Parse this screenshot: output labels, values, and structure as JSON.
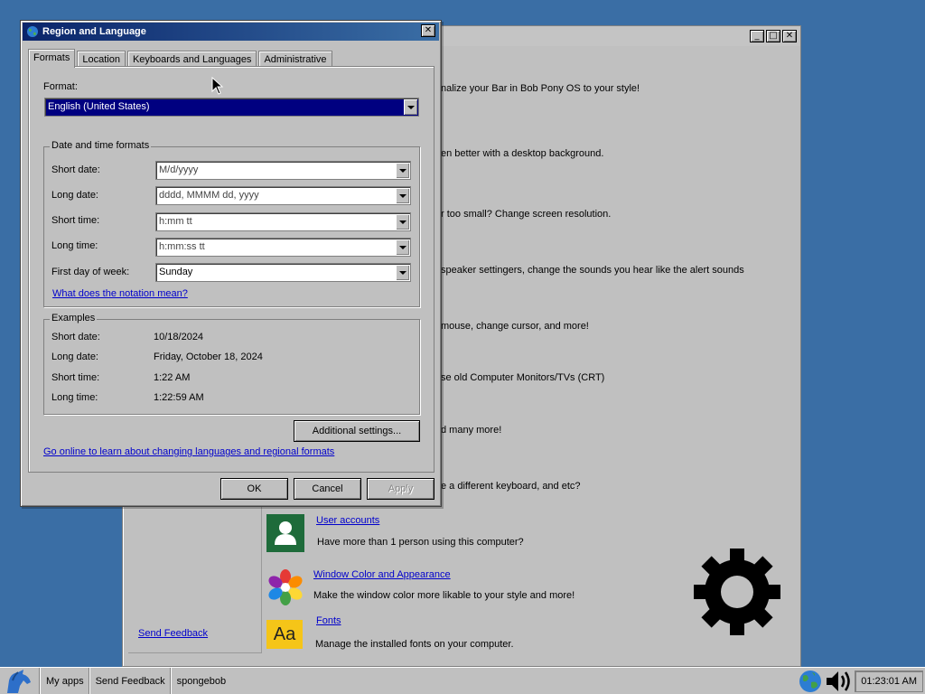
{
  "background_window": {
    "descriptions": [
      "nalize your Bar in Bob Pony OS to your style!",
      "en better with a desktop background.",
      "r too small? Change screen resolution.",
      "speaker settingers, change the sounds you hear like the alert sounds",
      "mouse, change cursor, and more!",
      "se old Computer Monitors/TVs (CRT)",
      "d many more!",
      "e a different keyboard, and etc?"
    ],
    "user_accounts": {
      "label": "User accounts",
      "desc": "Have more than 1 person using this computer?"
    },
    "window_color": {
      "label": "Window Color and Appearance",
      "desc": "Make the window color more likable to your style and more!"
    },
    "fonts": {
      "label": "Fonts",
      "desc": "Manage the installed fonts on your computer.",
      "icon_text": "Aa"
    },
    "send_feedback": "Send Feedback"
  },
  "dialog": {
    "title": "Region and Language",
    "close_glyph": "✕",
    "tabs": [
      {
        "label": "Formats"
      },
      {
        "label": "Location"
      },
      {
        "label": "Keyboards and Languages"
      },
      {
        "label": "Administrative"
      }
    ],
    "format_label": "Format:",
    "format_value": "English (United States)",
    "date_time_group": "Date and time formats",
    "short_date_label": "Short date:",
    "short_date_value": "M/d/yyyy",
    "long_date_label": "Long date:",
    "long_date_value": "dddd, MMMM dd, yyyy",
    "short_time_label": "Short time:",
    "short_time_value": "h:mm tt",
    "long_time_label": "Long time:",
    "long_time_value": "h:mm:ss tt",
    "first_day_label": "First day of week:",
    "first_day_value": "Sunday",
    "notation_link": "What does the notation mean?",
    "examples_group": "Examples",
    "ex_short_date_label": "Short date:",
    "ex_short_date_value": "10/18/2024",
    "ex_long_date_label": "Long date:",
    "ex_long_date_value": "Friday, October 18, 2024",
    "ex_short_time_label": "Short time:",
    "ex_short_time_value": "1:22 AM",
    "ex_long_time_label": "Long time:",
    "ex_long_time_value": "1:22:59 AM",
    "additional_settings": "Additional settings...",
    "online_link": "Go online to learn about changing languages and regional formats",
    "ok": "OK",
    "cancel": "Cancel",
    "apply": "Apply"
  },
  "taskbar": {
    "items": [
      "My apps",
      "Send Feedback",
      "spongebob"
    ],
    "clock": "01:23:01 AM"
  },
  "colors": {
    "desktop": "#3a6ea5",
    "selection": "#000080",
    "link": "#0000cc"
  }
}
